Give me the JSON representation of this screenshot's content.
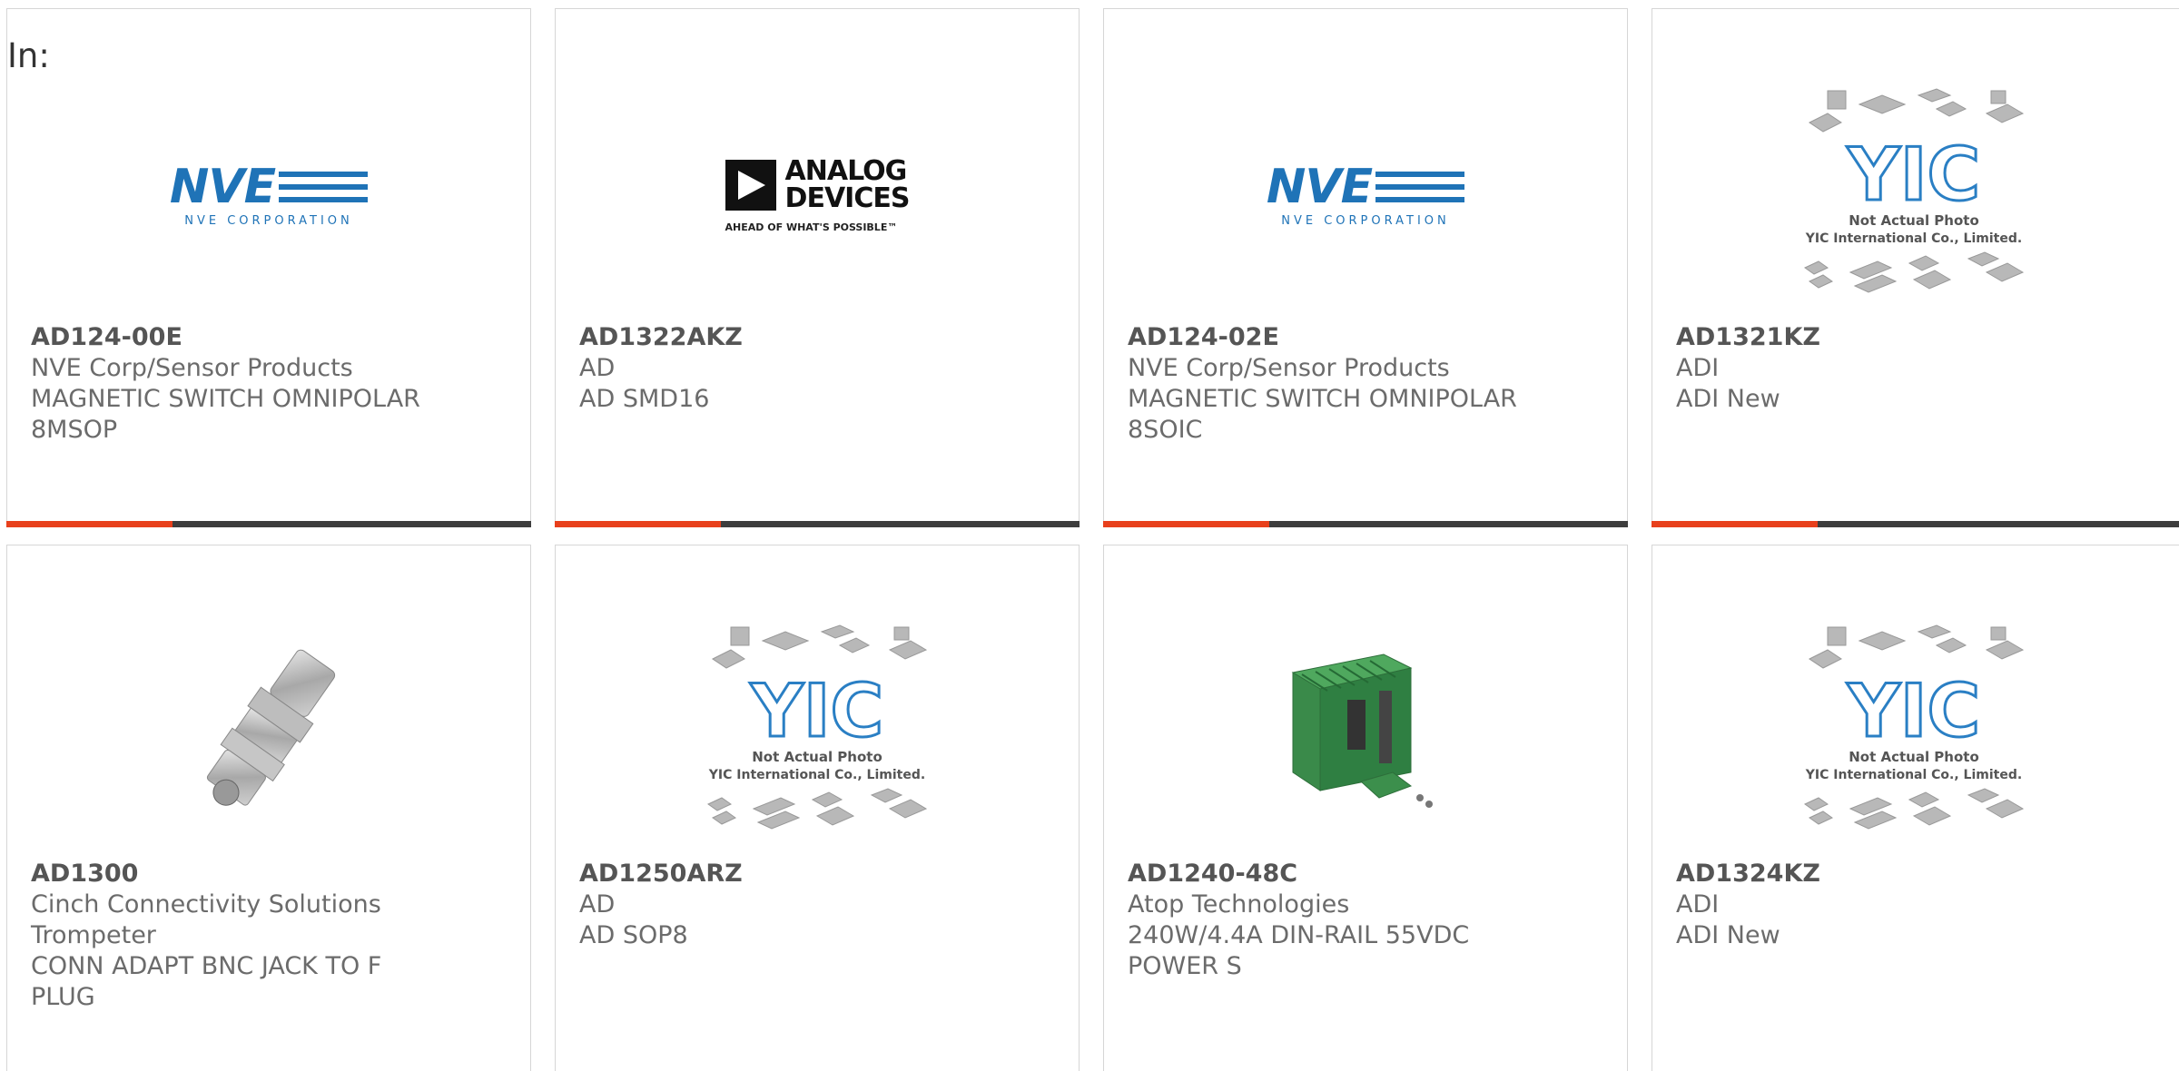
{
  "filter_label": "In:",
  "products": [
    {
      "part": "AD124-00E",
      "lines": [
        "NVE Corp/Sensor Products",
        "MAGNETIC SWITCH OMNIPOLAR",
        "8MSOP"
      ],
      "image": "nve-logo"
    },
    {
      "part": "AD1322AKZ",
      "lines": [
        "AD",
        "AD SMD16"
      ],
      "image": "analog-devices-logo"
    },
    {
      "part": "AD124-02E",
      "lines": [
        "NVE Corp/Sensor Products",
        "MAGNETIC SWITCH OMNIPOLAR",
        "8SOIC"
      ],
      "image": "nve-logo"
    },
    {
      "part": "AD1321KZ",
      "lines": [
        "ADI",
        "ADI New"
      ],
      "image": "yic-placeholder"
    },
    {
      "part": "AD1300",
      "lines": [
        "Cinch Connectivity Solutions",
        "Trompeter",
        "CONN ADAPT BNC JACK TO F",
        "PLUG"
      ],
      "image": "bnc-adapter-photo"
    },
    {
      "part": "AD1250ARZ",
      "lines": [
        "AD",
        "AD SOP8"
      ],
      "image": "yic-placeholder"
    },
    {
      "part": "AD1240-48C",
      "lines": [
        "Atop Technologies",
        "240W/4.4A DIN-RAIL 55VDC",
        "POWER S"
      ],
      "image": "power-supply-photo"
    },
    {
      "part": "AD1324KZ",
      "lines": [
        "ADI",
        "ADI New"
      ],
      "image": "yic-placeholder"
    }
  ],
  "logos": {
    "nve": {
      "text": "NVE",
      "sub": "NVE CORPORATION"
    },
    "adi": {
      "line1": "ANALOG",
      "line2": "DEVICES",
      "tagline": "AHEAD OF WHAT'S POSSIBLE™"
    },
    "yic": {
      "text": "YIC",
      "line1": "Not Actual Photo",
      "line2": "YIC International Co., Limited."
    }
  },
  "colors": {
    "accent": "#e8401c",
    "bar": "#3d3d3d",
    "nve_blue": "#1f73b7",
    "yic_blue": "#2a7fc4",
    "text": "#6b6b6b"
  }
}
